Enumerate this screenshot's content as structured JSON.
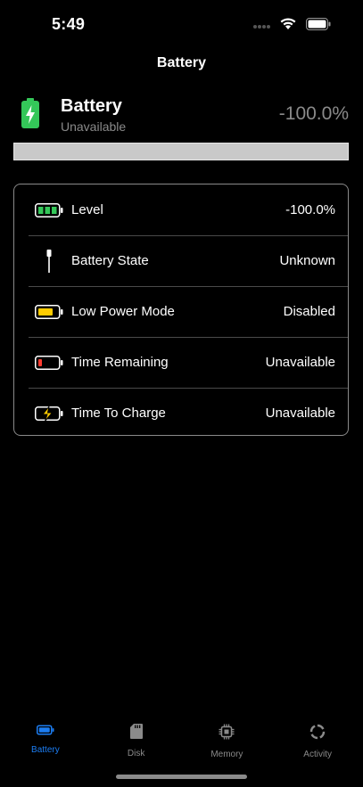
{
  "status": {
    "time": "5:49"
  },
  "nav": {
    "title": "Battery"
  },
  "header": {
    "title": "Battery",
    "subtitle": "Unavailable",
    "percent": "-100.0%",
    "level_fraction": 0
  },
  "rows": [
    {
      "label": "Level",
      "value": "-100.0%",
      "icon": "battery-level-icon"
    },
    {
      "label": "Battery State",
      "value": "Unknown",
      "icon": "charging-cable-icon"
    },
    {
      "label": "Low Power Mode",
      "value": "Disabled",
      "icon": "low-power-battery-icon"
    },
    {
      "label": "Time Remaining",
      "value": "Unavailable",
      "icon": "low-battery-icon"
    },
    {
      "label": "Time To Charge",
      "value": "Unavailable",
      "icon": "battery-charging-icon"
    }
  ],
  "tabs": [
    {
      "label": "Battery",
      "icon": "battery-tab-icon",
      "active": true
    },
    {
      "label": "Disk",
      "icon": "sd-card-icon",
      "active": false
    },
    {
      "label": "Memory",
      "icon": "chip-icon",
      "active": false
    },
    {
      "label": "Activity",
      "icon": "activity-ring-icon",
      "active": false
    }
  ],
  "colors": {
    "accent": "#1c7df2",
    "green": "#34c759",
    "yellow": "#ffcc00",
    "red": "#ff3b30",
    "secondary": "#8a8a8a"
  }
}
